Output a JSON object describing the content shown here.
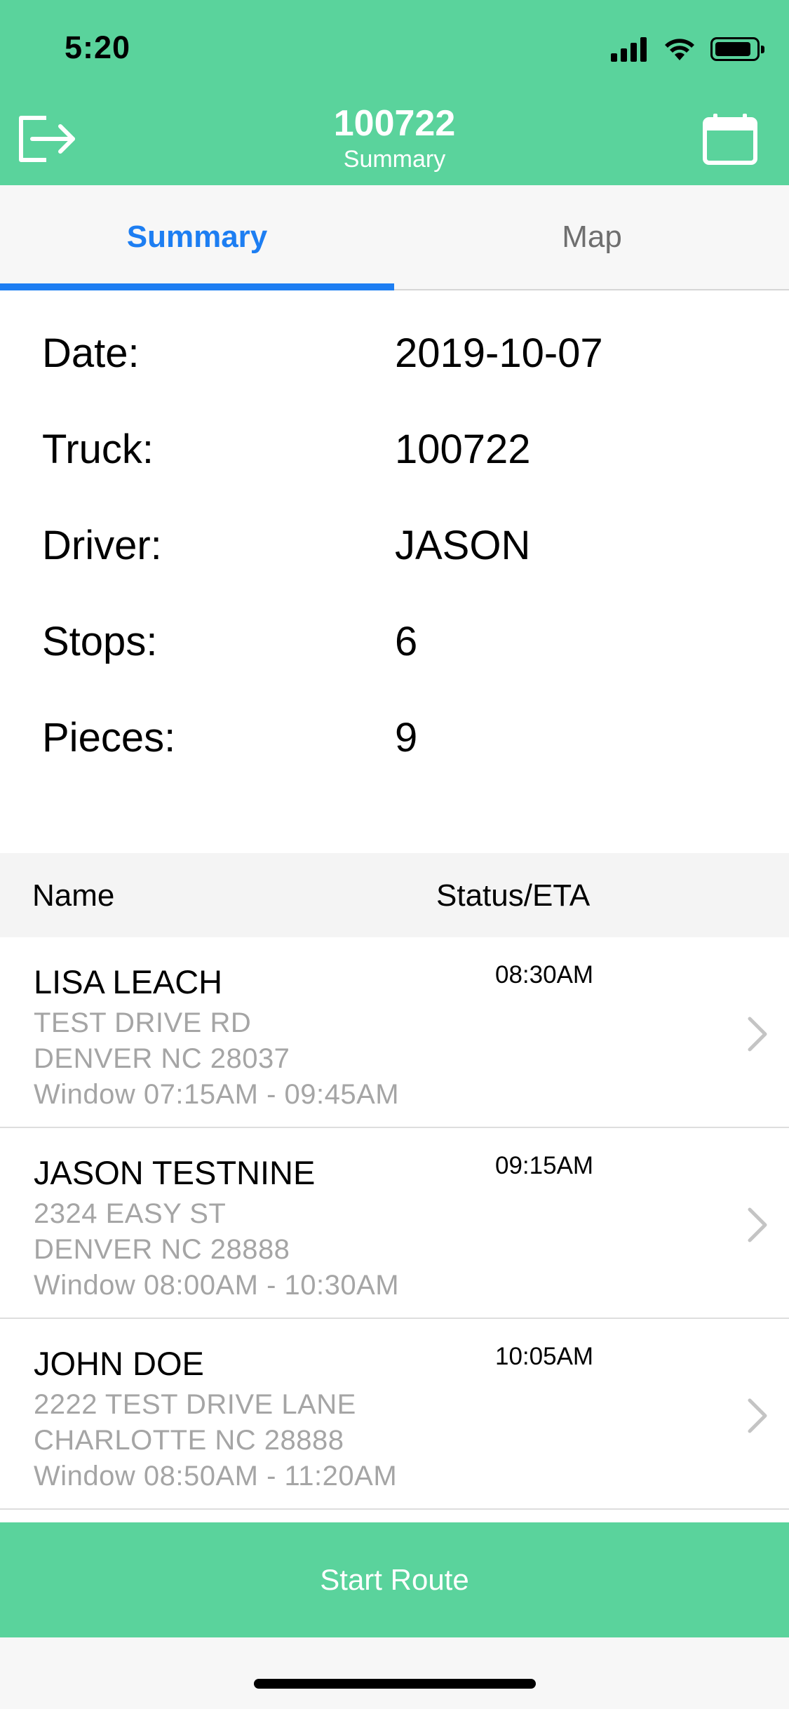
{
  "status_bar": {
    "time": "5:20"
  },
  "nav": {
    "title": "100722",
    "subtitle": "Summary"
  },
  "tabs": [
    {
      "label": "Summary",
      "selected": true
    },
    {
      "label": "Map",
      "selected": false
    }
  ],
  "summary": {
    "rows": [
      {
        "label": "Date:",
        "value": "2019-10-07"
      },
      {
        "label": "Truck:",
        "value": "100722"
      },
      {
        "label": "Driver:",
        "value": "JASON"
      },
      {
        "label": "Stops:",
        "value": "6"
      },
      {
        "label": "Pieces:",
        "value": "9"
      }
    ]
  },
  "table": {
    "headers": {
      "name": "Name",
      "status": "Status/ETA"
    },
    "rows": [
      {
        "name": "LISA LEACH",
        "eta": "08:30AM",
        "address": "TEST DRIVE RD",
        "city": "DENVER NC 28037",
        "window": "Window 07:15AM - 09:45AM"
      },
      {
        "name": "JASON TESTNINE",
        "eta": "09:15AM",
        "address": "2324 EASY ST",
        "city": "DENVER NC 28888",
        "window": "Window 08:00AM - 10:30AM"
      },
      {
        "name": "JOHN DOE",
        "eta": "10:05AM",
        "address": "2222 TEST DRIVE LANE",
        "city": "CHARLOTTE NC 28888",
        "window": "Window 08:50AM - 11:20AM"
      }
    ]
  },
  "footer": {
    "button_label": "Start Route"
  },
  "colors": {
    "header_green": "#5ad39c",
    "tab_active_blue": "#1d7ef2",
    "secondary_text": "#a5a5a5"
  },
  "icons": [
    "exit-icon",
    "calendar-icon",
    "signal-icon",
    "wifi-icon",
    "battery-icon",
    "chevron-right-icon"
  ]
}
